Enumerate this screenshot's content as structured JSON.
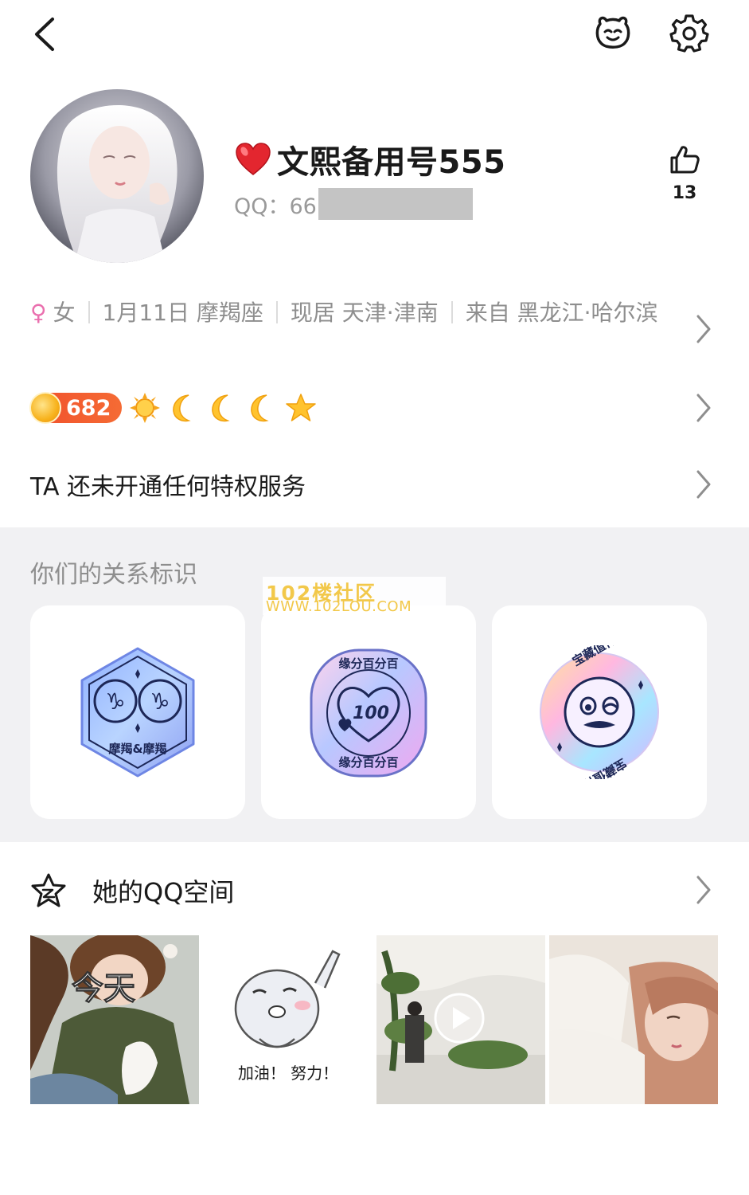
{
  "header": {
    "back_icon": "chevron-left-icon",
    "pet_icon": "pet-face-icon",
    "settings_icon": "gear-icon"
  },
  "profile": {
    "nickname_prefix_icon": "red-heart-icon",
    "nickname": "文熙备用号555",
    "qq_label": "QQ：66",
    "likes": "13",
    "like_icon": "thumbs-up-icon"
  },
  "info": {
    "gender_symbol": "♀",
    "gender": "女",
    "birthday": "1月11日 摩羯座",
    "residence": "现居 天津·津南",
    "hometown": "来自 黑龙江·哈尔滨"
  },
  "level": {
    "points": "682",
    "icons": [
      "sun-icon",
      "moon-icon",
      "moon-icon",
      "moon-icon",
      "star-icon"
    ]
  },
  "privilege": {
    "text": "TA 还未开通任何特权服务"
  },
  "relations": {
    "title": "你们的关系标识",
    "cards": [
      {
        "icon": "capricorn-badge-icon",
        "label": "摩羯&摩羯"
      },
      {
        "icon": "heart-100-badge-icon",
        "label": "缘分百分百",
        "number": "100"
      },
      {
        "icon": "treasure-face-badge-icon",
        "label": "宝藏值得挖掘"
      }
    ]
  },
  "watermark": {
    "line1": "102楼社区",
    "line2": "WWW.102LOU.COM"
  },
  "zone": {
    "title": "她的QQ空间",
    "photos": [
      {
        "icon": "photo-girl-sweater-icon",
        "caption": "今天"
      },
      {
        "icon": "photo-hamster-sticker-icon",
        "caption": "加油！ 努力！"
      },
      {
        "icon": "photo-video-plants-icon"
      },
      {
        "icon": "photo-selfie-icon"
      }
    ]
  },
  "colors": {
    "accent_red": "#f1502c",
    "female_pink": "#ea6fae",
    "muted_text": "#8e8e8e",
    "section_bg": "#f1f1f3"
  }
}
